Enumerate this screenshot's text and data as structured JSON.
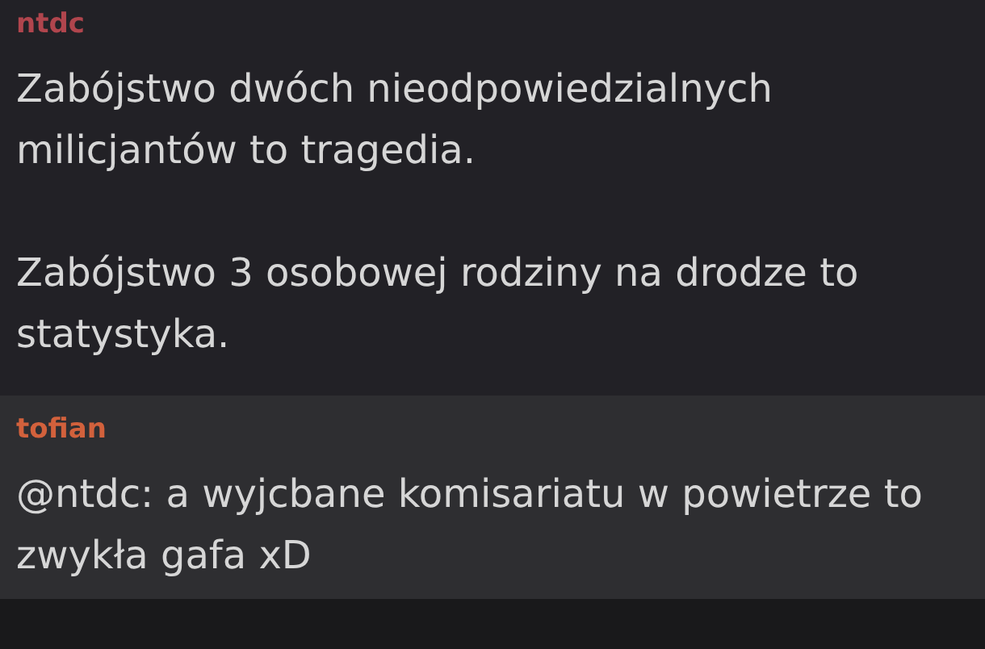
{
  "comments": [
    {
      "author": "ntdc",
      "color": "#b0454d",
      "paragraphs": [
        "Zabójstwo dwóch nieodpowiedzialnych milicjantów to tragedia.",
        "Zabójstwo 3 osobowej rodziny na drodze to statystyka."
      ],
      "highlighted": false
    },
    {
      "author": "tofian",
      "color": "#d2613c",
      "paragraphs": [
        "@ntdc: a wyjcbane komisariatu w powietrze to zwykła gafa xD"
      ],
      "highlighted": true
    }
  ]
}
